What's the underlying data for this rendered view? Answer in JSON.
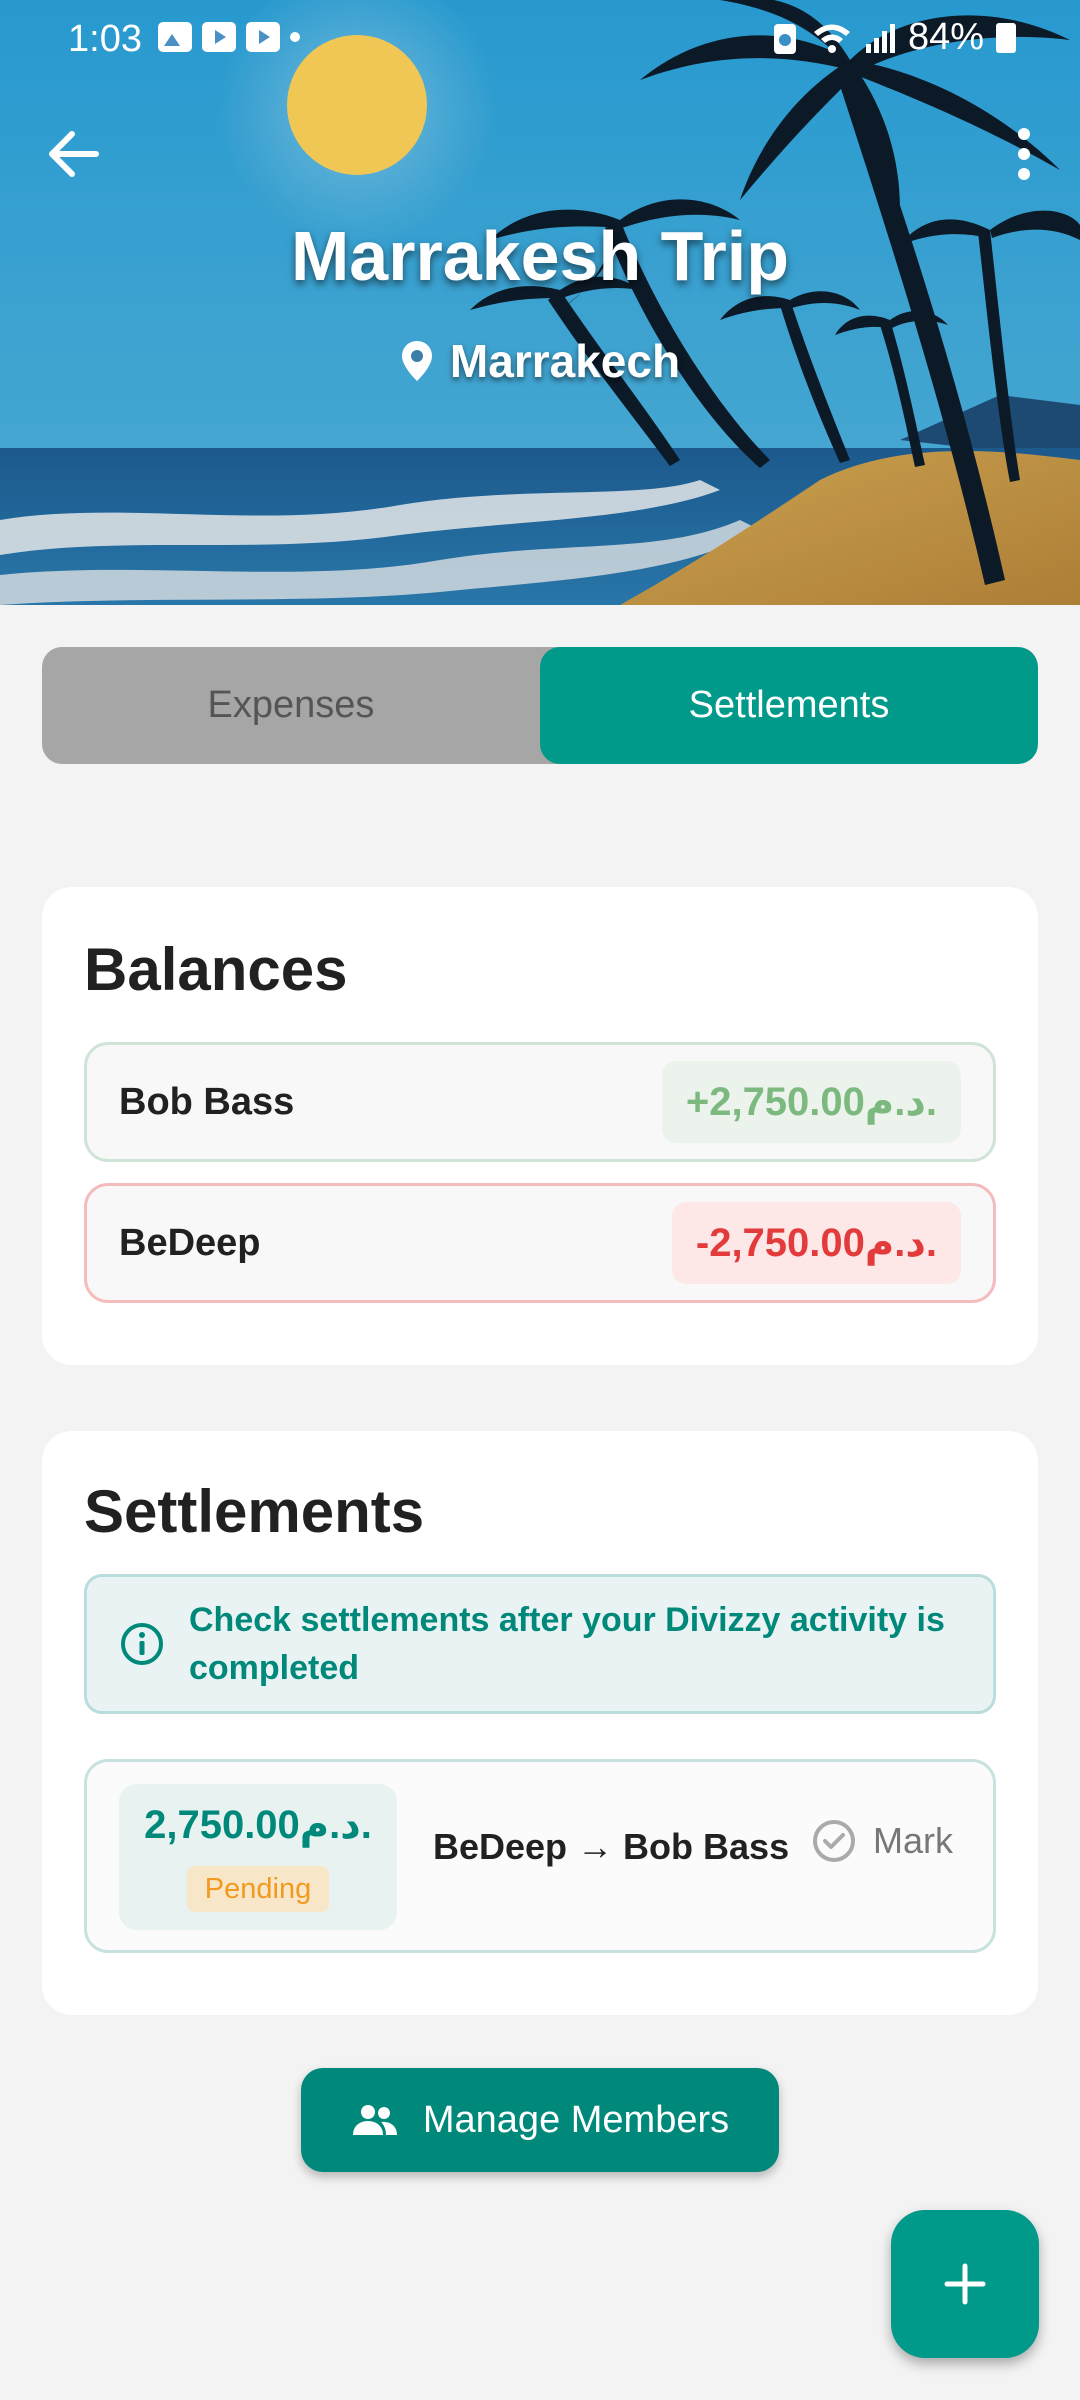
{
  "status_bar": {
    "time": "1:03",
    "battery": "84%"
  },
  "header": {
    "title": "Marrakesh Trip",
    "location": "Marrakech",
    "back_icon": "arrow-left-icon",
    "menu_icon": "more-vert-icon"
  },
  "tabs": [
    {
      "label": "Expenses",
      "active": false
    },
    {
      "label": "Settlements",
      "active": true
    }
  ],
  "balances": {
    "title": "Balances",
    "items": [
      {
        "name": "Bob Bass",
        "amount": "+2,750.00د.م.",
        "status": "positive"
      },
      {
        "name": "BeDeep",
        "amount": "-2,750.00د.م.",
        "status": "negative"
      }
    ]
  },
  "settlements": {
    "title": "Settlements",
    "info": "Check settlements after your Divizzy activity is completed",
    "items": [
      {
        "amount": "2,750.00د.م.",
        "status": "Pending",
        "from_to": "BeDeep → Bob Bass",
        "action": "Mark"
      }
    ]
  },
  "manage_members": {
    "label": "Manage Members",
    "icon": "group-icon"
  },
  "fab": {
    "icon": "plus-icon"
  },
  "colors": {
    "primary": "#00998a",
    "positive_text": "#7cb97f",
    "positive_bg": "#ecf3ec",
    "negative_text": "#e33b3b",
    "negative_bg": "#fde7e7",
    "pending_text": "#f29a1f",
    "pending_bg": "#f7e6c7"
  }
}
